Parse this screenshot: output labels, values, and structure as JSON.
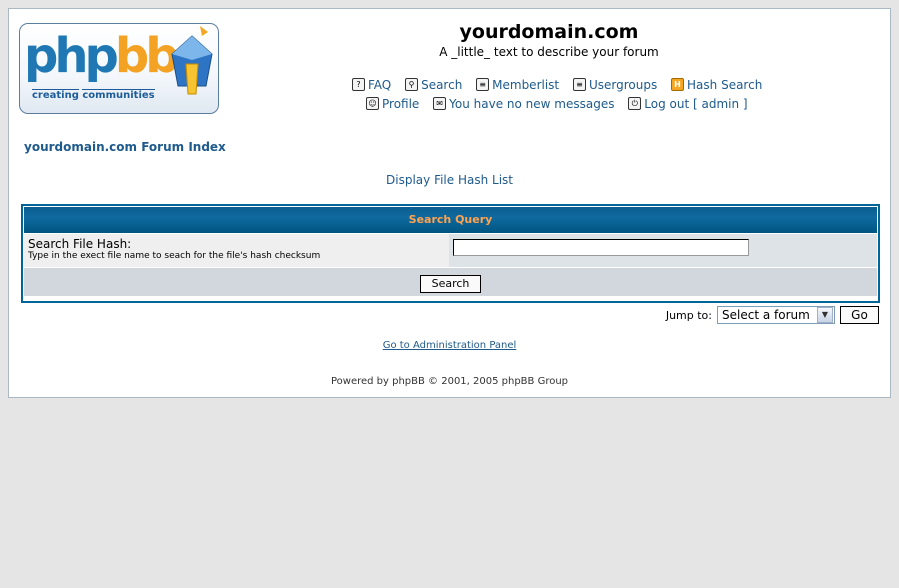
{
  "logo": {
    "php": "php",
    "bb": "bb",
    "tagline_left": "creating",
    "tagline_right": "communities"
  },
  "header": {
    "site_name": "yourdomain.com",
    "site_description": "A _little_ text to describe your forum"
  },
  "nav": {
    "faq": "FAQ",
    "search": "Search",
    "memberlist": "Memberlist",
    "usergroups": "Usergroups",
    "hash_search": "Hash Search",
    "profile": "Profile",
    "messages": "You have no new messages",
    "logout": "Log out [ admin ]"
  },
  "breadcrumb": {
    "forum_index": "yourdomain.com Forum Index"
  },
  "display_link": "Display File Hash List",
  "search_panel": {
    "header": "Search Query",
    "field_label": "Search File Hash:",
    "field_help": "Type in the exect file name to seach for the file's hash checksum",
    "field_value": "",
    "submit_label": "Search"
  },
  "jump": {
    "label": "Jump to:",
    "selected": "Select a forum",
    "go_label": "Go"
  },
  "footer": {
    "admin_link": "Go to Administration Panel",
    "copyright": "Powered by phpBB © 2001, 2005 phpBB Group"
  },
  "colors": {
    "accent": "#006699",
    "header_text": "#ffa34f",
    "row_light": "#efefef",
    "row_dark": "#dee3e7",
    "background": "#e5e5e5"
  }
}
